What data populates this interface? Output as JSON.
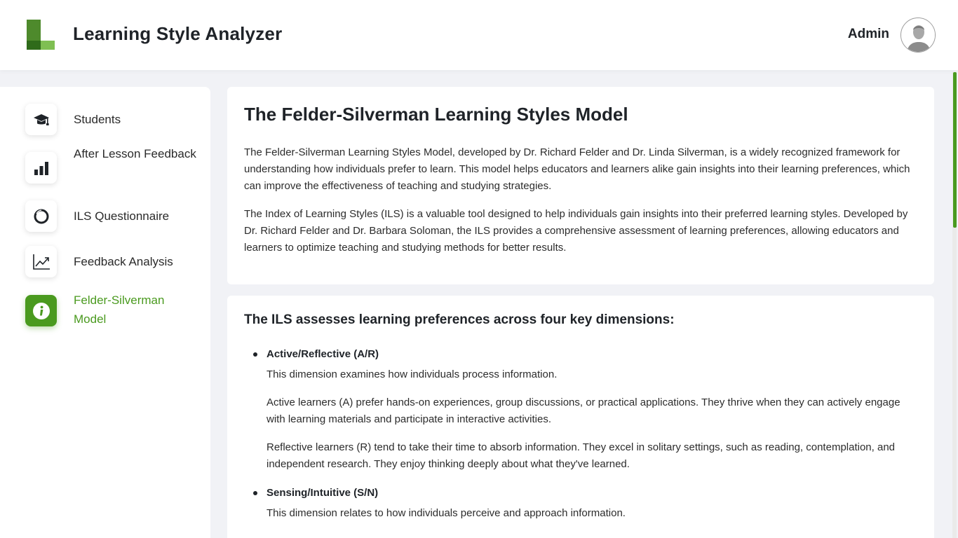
{
  "header": {
    "app_title": "Learning Style Analyzer",
    "user_name": "Admin"
  },
  "sidebar": {
    "items": [
      {
        "label": "Students",
        "icon": "graduation-cap-icon",
        "active": false
      },
      {
        "label": "After Lesson Feedback",
        "icon": "bar-chart-icon",
        "active": false
      },
      {
        "label": "ILS Questionnaire",
        "icon": "circle-icon",
        "active": false
      },
      {
        "label": "Feedback Analysis",
        "icon": "trend-chart-icon",
        "active": false
      },
      {
        "label": "Felder-Silverman Model",
        "icon": "info-icon",
        "active": true
      }
    ]
  },
  "main": {
    "title": "The Felder-Silverman Learning Styles Model",
    "intro_p1": "The Felder-Silverman Learning Styles Model, developed by Dr. Richard Felder and Dr. Linda Silverman, is a widely recognized framework for understanding how individuals prefer to learn. This model helps educators and learners alike gain insights into their learning preferences, which can improve the effectiveness of teaching and studying strategies.",
    "intro_p2": "The Index of Learning Styles (ILS) is a valuable tool designed to help individuals gain insights into their preferred learning styles. Developed by Dr. Richard Felder and Dr. Barbara Soloman, the ILS provides a comprehensive assessment of learning preferences, allowing educators and learners to optimize teaching and studying methods for better results.",
    "dimensions_heading": "The ILS assesses learning preferences across four key dimensions:",
    "dimensions": [
      {
        "title": "Active/Reflective (A/R)",
        "summary": "This dimension examines how individuals process information.",
        "p1": "Active learners (A) prefer hands-on experiences, group discussions, or practical applications. They thrive when they can actively engage with learning materials and participate in interactive activities.",
        "p2": "Reflective learners (R) tend to take their time to absorb information. They excel in solitary settings, such as reading, contemplation, and independent research. They enjoy thinking deeply about what they've learned."
      },
      {
        "title": "Sensing/Intuitive (S/N)",
        "summary": "This dimension relates to how individuals perceive and approach information."
      }
    ]
  },
  "colors": {
    "accent": "#4a9a1f",
    "background": "#f1f2f6"
  }
}
